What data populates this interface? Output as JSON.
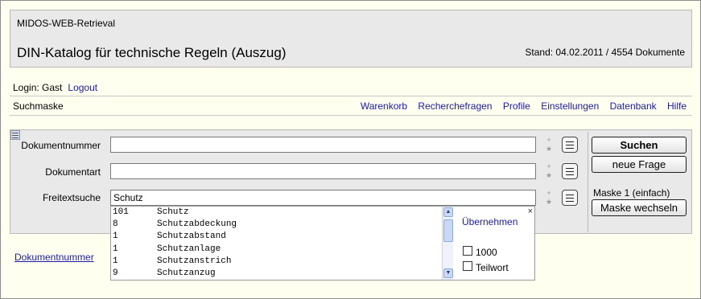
{
  "header": {
    "app_name": "MIDOS-WEB-Retrieval",
    "title": "DIN-Katalog für technische Regeln (Auszug)",
    "stand": "Stand: 04.02.2011 / 4554 Dokumente"
  },
  "login": {
    "text": "Login: Gast",
    "logout": "Logout"
  },
  "subheader": {
    "label": "Suchmaske"
  },
  "nav": [
    "Warenkorb",
    "Recherchefragen",
    "Profile",
    "Einstellungen",
    "Datenbank",
    "Hilfe"
  ],
  "form": {
    "fields": [
      {
        "label": "Dokumentnummer",
        "value": ""
      },
      {
        "label": "Dokumentart",
        "value": ""
      },
      {
        "label": "Freitextsuche",
        "value": "Schutz"
      }
    ],
    "plus": "+",
    "star": "★"
  },
  "buttons": {
    "search": "Suchen",
    "new_query": "neue Frage",
    "mask_label": "Maske 1 (einfach)",
    "switch_mask": "Maske wechseln"
  },
  "suggestions": {
    "items": [
      {
        "count": "101",
        "term": "Schutz"
      },
      {
        "count": "8",
        "term": "Schutzabdeckung"
      },
      {
        "count": "1",
        "term": "Schutzabstand"
      },
      {
        "count": "1",
        "term": "Schutzanlage"
      },
      {
        "count": "1",
        "term": "Schutzanstrich"
      },
      {
        "count": "9",
        "term": "Schutzanzug"
      }
    ],
    "apply": "Übernehmen",
    "close": "×",
    "options": [
      {
        "label": "1000",
        "checked": false
      },
      {
        "label": "Teilwort",
        "checked": false
      }
    ]
  },
  "result_link": "Dokumentnummer"
}
